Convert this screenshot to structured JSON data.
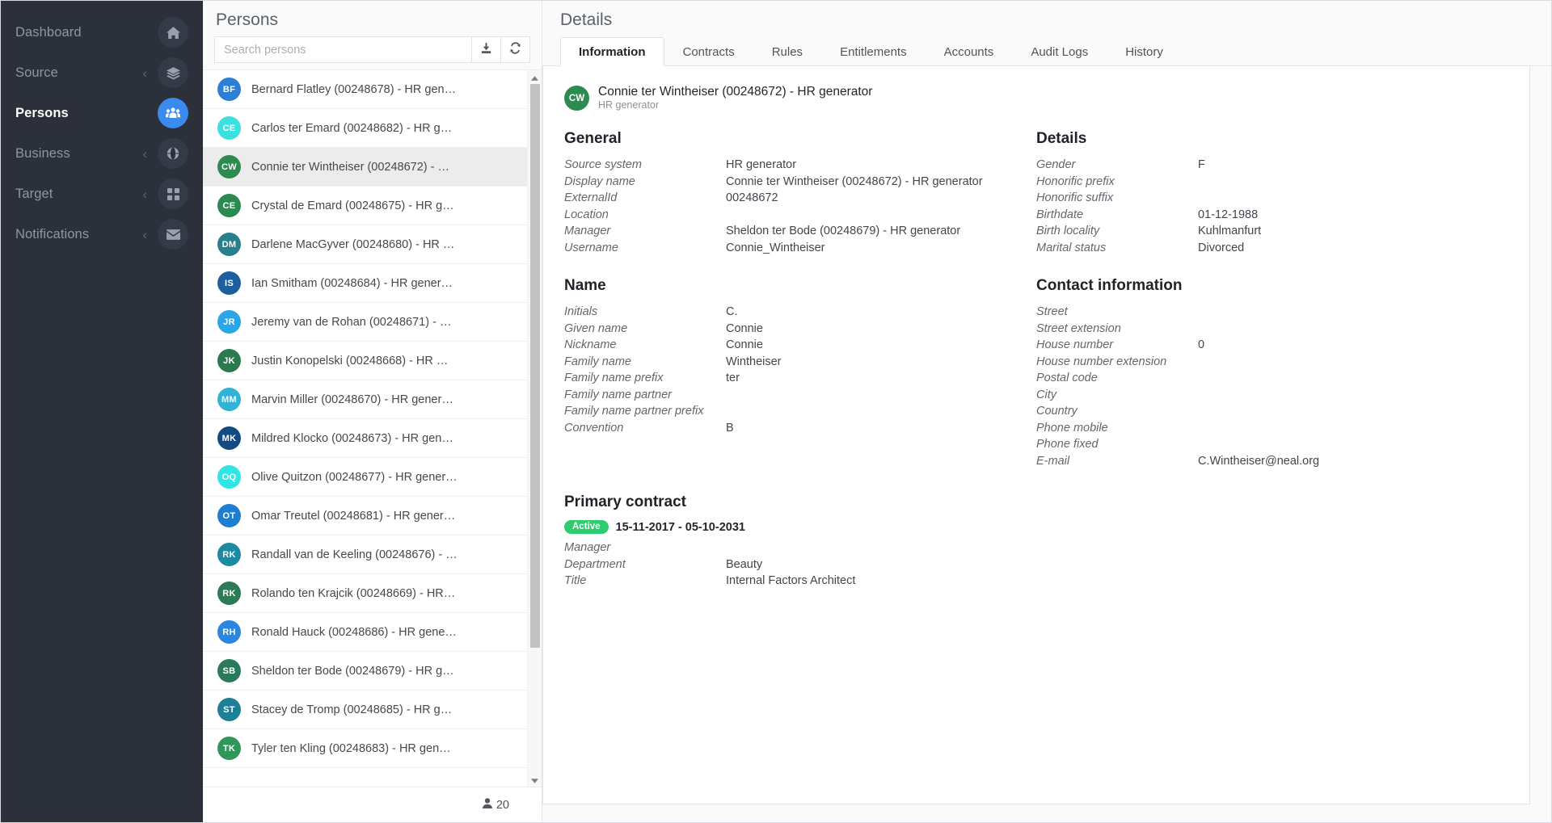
{
  "sidebar": {
    "items": [
      {
        "label": "Dashboard",
        "icon": "home-icon",
        "caret": false,
        "active": false
      },
      {
        "label": "Source",
        "icon": "layers-icon",
        "caret": true,
        "active": false
      },
      {
        "label": "Persons",
        "icon": "people-icon",
        "caret": false,
        "active": true
      },
      {
        "label": "Business",
        "icon": "globe-icon",
        "caret": true,
        "active": false
      },
      {
        "label": "Target",
        "icon": "grid-icon",
        "caret": true,
        "active": false
      },
      {
        "label": "Notifications",
        "icon": "envelope-icon",
        "caret": true,
        "active": false
      }
    ],
    "accent_color": "#3a8bed",
    "background_color": "#2b303b"
  },
  "persons": {
    "title": "Persons",
    "search": {
      "value": "",
      "placeholder": "Search persons"
    },
    "actions": [
      {
        "name": "download-button",
        "icon": "download-icon"
      },
      {
        "name": "refresh-button",
        "icon": "refresh-icon"
      }
    ],
    "footer": {
      "icon": "person-icon",
      "count": "20"
    },
    "list": [
      {
        "initials": "BF",
        "color": "#2b7fd4",
        "name": "Bernard Flatley (00248678) - HR gen…",
        "selected": false
      },
      {
        "initials": "CE",
        "color": "#3ce0e0",
        "name": "Carlos ter Emard (00248682) - HR g…",
        "selected": false
      },
      {
        "initials": "CW",
        "color": "#2e8b4f",
        "name": "Connie ter Wintheiser (00248672) - …",
        "selected": true
      },
      {
        "initials": "CE",
        "color": "#2a8a4f",
        "name": "Crystal de Emard (00248675) - HR g…",
        "selected": false
      },
      {
        "initials": "DM",
        "color": "#2a7f8c",
        "name": "Darlene MacGyver (00248680) - HR …",
        "selected": false
      },
      {
        "initials": "IS",
        "color": "#1c5f9e",
        "name": "Ian Smitham (00248684) - HR gener…",
        "selected": false
      },
      {
        "initials": "JR",
        "color": "#2aa6e8",
        "name": "Jeremy van de Rohan (00248671) - …",
        "selected": false
      },
      {
        "initials": "JK",
        "color": "#2a7a4e",
        "name": "Justin Konopelski (00248668) - HR …",
        "selected": false
      },
      {
        "initials": "MM",
        "color": "#31b2d6",
        "name": "Marvin Miller (00248670) - HR gener…",
        "selected": false
      },
      {
        "initials": "MK",
        "color": "#134a82",
        "name": "Mildred Klocko (00248673) - HR gen…",
        "selected": false
      },
      {
        "initials": "OQ",
        "color": "#32e5e5",
        "name": "Olive Quitzon (00248677) - HR gener…",
        "selected": false
      },
      {
        "initials": "OT",
        "color": "#1e7fd0",
        "name": "Omar Treutel (00248681) - HR gener…",
        "selected": false
      },
      {
        "initials": "RK",
        "color": "#1c8aa3",
        "name": "Randall van de Keeling (00248676) - …",
        "selected": false
      },
      {
        "initials": "RK",
        "color": "#2c7a56",
        "name": "Rolando ten Krajcik (00248669) - HR…",
        "selected": false
      },
      {
        "initials": "RH",
        "color": "#2b86e0",
        "name": "Ronald Hauck (00248686) - HR gene…",
        "selected": false
      },
      {
        "initials": "SB",
        "color": "#2c7a5c",
        "name": "Sheldon ter Bode (00248679) - HR g…",
        "selected": false
      },
      {
        "initials": "ST",
        "color": "#1d8099",
        "name": "Stacey de Tromp (00248685) - HR g…",
        "selected": false
      },
      {
        "initials": "TK",
        "color": "#2f9757",
        "name": "Tyler ten Kling (00248683) - HR gen…",
        "selected": false
      }
    ]
  },
  "details": {
    "title": "Details",
    "tabs": [
      {
        "label": "Information",
        "active": true
      },
      {
        "label": "Contracts",
        "active": false
      },
      {
        "label": "Rules",
        "active": false
      },
      {
        "label": "Entitlements",
        "active": false
      },
      {
        "label": "Accounts",
        "active": false
      },
      {
        "label": "Audit Logs",
        "active": false
      },
      {
        "label": "History",
        "active": false
      }
    ],
    "entity": {
      "initials": "CW",
      "avatar_color": "#2e8b4f",
      "title": "Connie ter Wintheiser (00248672) - HR generator",
      "subtitle": "HR generator"
    },
    "general": {
      "title": "General",
      "rows": [
        {
          "key": "Source system",
          "value": "HR generator"
        },
        {
          "key": "Display name",
          "value": "Connie ter Wintheiser (00248672) - HR generator"
        },
        {
          "key": "ExternalId",
          "value": "00248672"
        },
        {
          "key": "Location",
          "value": ""
        },
        {
          "key": "Manager",
          "value": "Sheldon ter Bode (00248679) - HR generator"
        },
        {
          "key": "Username",
          "value": "Connie_Wintheiser"
        }
      ]
    },
    "name": {
      "title": "Name",
      "rows": [
        {
          "key": "Initials",
          "value": "C."
        },
        {
          "key": "Given name",
          "value": "Connie"
        },
        {
          "key": "Nickname",
          "value": "Connie"
        },
        {
          "key": "Family name",
          "value": "Wintheiser"
        },
        {
          "key": "Family name prefix",
          "value": "ter"
        },
        {
          "key": "Family name partner",
          "value": ""
        },
        {
          "key": "Family name partner prefix",
          "value": ""
        },
        {
          "key": "Convention",
          "value": "B"
        }
      ]
    },
    "details_section": {
      "title": "Details",
      "rows": [
        {
          "key": "Gender",
          "value": "F"
        },
        {
          "key": "Honorific prefix",
          "value": ""
        },
        {
          "key": "Honorific suffix",
          "value": ""
        },
        {
          "key": "Birthdate",
          "value": "01-12-1988"
        },
        {
          "key": "Birth locality",
          "value": "Kuhlmanfurt"
        },
        {
          "key": "Marital status",
          "value": "Divorced"
        }
      ]
    },
    "contact": {
      "title": "Contact information",
      "rows": [
        {
          "key": "Street",
          "value": ""
        },
        {
          "key": "Street extension",
          "value": ""
        },
        {
          "key": "House number",
          "value": "0"
        },
        {
          "key": "House number extension",
          "value": ""
        },
        {
          "key": "Postal code",
          "value": ""
        },
        {
          "key": "City",
          "value": ""
        },
        {
          "key": "Country",
          "value": ""
        },
        {
          "key": "Phone mobile",
          "value": ""
        },
        {
          "key": "Phone fixed",
          "value": ""
        },
        {
          "key": "E-mail",
          "value": "C.Wintheiser@neal.org"
        }
      ]
    },
    "primary_contract": {
      "title": "Primary contract",
      "status_badge": "Active",
      "status_color": "#2ecc71",
      "dates": "15-11-2017 - 05-10-2031",
      "rows": [
        {
          "key": "Manager",
          "value": ""
        },
        {
          "key": "Department",
          "value": "Beauty"
        },
        {
          "key": "Title",
          "value": "Internal Factors Architect"
        }
      ]
    }
  }
}
